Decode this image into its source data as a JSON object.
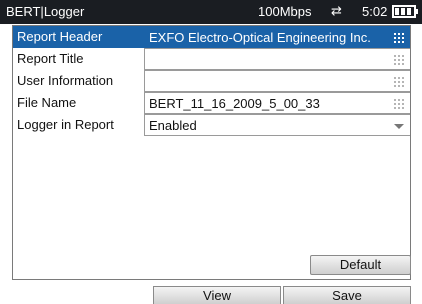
{
  "titlebar": {
    "title": "BERT|Logger",
    "speed": "100Mbps",
    "link_icon": "link-arrows-icon",
    "time": "5:02",
    "battery_icon": "battery-icon"
  },
  "rows": [
    {
      "label": "Report Header",
      "value": "EXFO Electro-Optical Engineering Inc.",
      "control": "keyboard",
      "selected": true
    },
    {
      "label": "Report Title",
      "value": "",
      "control": "keyboard"
    },
    {
      "label": "User Information",
      "value": "",
      "control": "keyboard"
    },
    {
      "label": "File Name",
      "value": "BERT_11_16_2009_5_00_33",
      "control": "keyboard"
    },
    {
      "label": "Logger in Report",
      "value": "Enabled",
      "control": "dropdown"
    }
  ],
  "buttons": {
    "default": "Default",
    "view": "View",
    "save": "Save"
  },
  "colors": {
    "titlebar_bg": "#1a1d22",
    "selection": "#1a62a8"
  }
}
